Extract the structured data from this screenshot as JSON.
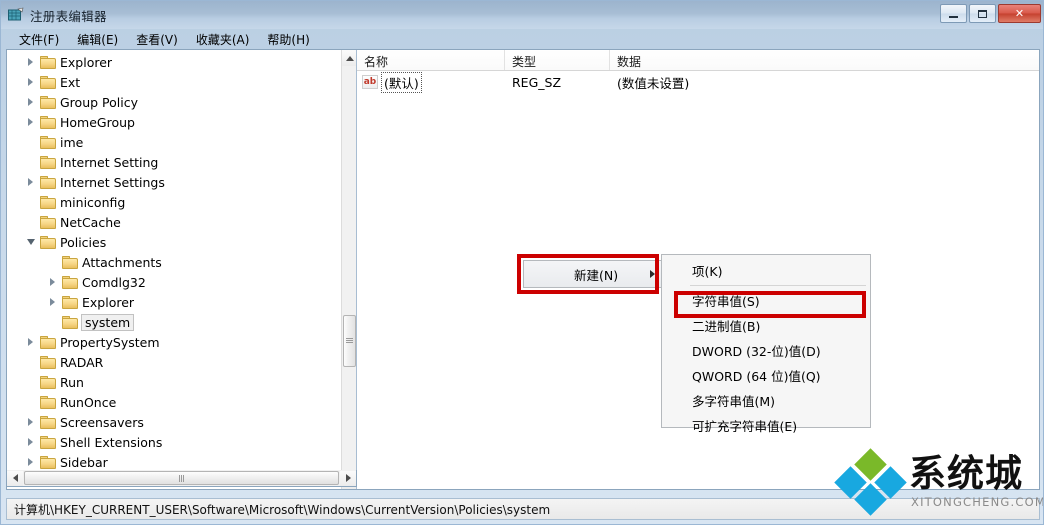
{
  "window": {
    "title": "注册表编辑器",
    "icon": "registry-editor-icon",
    "controls": {
      "minimize": "minimize-icon",
      "maximize": "maximize-icon",
      "close": "✕"
    }
  },
  "menubar": {
    "items": [
      {
        "label": "文件(F)"
      },
      {
        "label": "编辑(E)"
      },
      {
        "label": "查看(V)"
      },
      {
        "label": "收藏夹(A)"
      },
      {
        "label": "帮助(H)"
      }
    ]
  },
  "tree": {
    "items": [
      {
        "label": "Explorer",
        "indent": 2,
        "expander": "collapsed",
        "selected": false
      },
      {
        "label": "Ext",
        "indent": 2,
        "expander": "collapsed",
        "selected": false
      },
      {
        "label": "Group Policy",
        "indent": 2,
        "expander": "collapsed",
        "selected": false
      },
      {
        "label": "HomeGroup",
        "indent": 2,
        "expander": "collapsed",
        "selected": false
      },
      {
        "label": "ime",
        "indent": 2,
        "expander": "none",
        "selected": false
      },
      {
        "label": "Internet Setting",
        "indent": 2,
        "expander": "none",
        "selected": false
      },
      {
        "label": "Internet Settings",
        "indent": 2,
        "expander": "collapsed",
        "selected": false
      },
      {
        "label": "miniconfig",
        "indent": 2,
        "expander": "none",
        "selected": false
      },
      {
        "label": "NetCache",
        "indent": 2,
        "expander": "none",
        "selected": false
      },
      {
        "label": "Policies",
        "indent": 2,
        "expander": "expanded",
        "selected": false
      },
      {
        "label": "Attachments",
        "indent": 3,
        "expander": "none",
        "selected": false
      },
      {
        "label": "Comdlg32",
        "indent": 3,
        "expander": "collapsed",
        "selected": false
      },
      {
        "label": "Explorer",
        "indent": 3,
        "expander": "collapsed",
        "selected": false
      },
      {
        "label": "system",
        "indent": 3,
        "expander": "none",
        "selected": true
      },
      {
        "label": "PropertySystem",
        "indent": 2,
        "expander": "collapsed",
        "selected": false
      },
      {
        "label": "RADAR",
        "indent": 2,
        "expander": "none",
        "selected": false
      },
      {
        "label": "Run",
        "indent": 2,
        "expander": "none",
        "selected": false
      },
      {
        "label": "RunOnce",
        "indent": 2,
        "expander": "none",
        "selected": false
      },
      {
        "label": "Screensavers",
        "indent": 2,
        "expander": "collapsed",
        "selected": false
      },
      {
        "label": "Shell Extensions",
        "indent": 2,
        "expander": "collapsed",
        "selected": false
      },
      {
        "label": "Sidebar",
        "indent": 2,
        "expander": "collapsed",
        "selected": false
      }
    ]
  },
  "list": {
    "headers": [
      "名称",
      "类型",
      "数据"
    ],
    "rows": [
      {
        "name": "(默认)",
        "type": "REG_SZ",
        "data": "(数值未设置)",
        "icon": "string-value-icon"
      }
    ]
  },
  "context_menu": {
    "parent": {
      "label": "新建(N)",
      "submenu_arrow": "chevron-right-icon"
    },
    "submenu_items": [
      {
        "label": "项(K)"
      },
      {
        "label": "字符串值(S)"
      },
      {
        "label": "二进制值(B)"
      },
      {
        "label": "DWORD (32-位)值(D)"
      },
      {
        "label": "QWORD (64 位)值(Q)"
      },
      {
        "label": "多字符串值(M)"
      },
      {
        "label": "可扩充字符串值(E)"
      }
    ]
  },
  "statusbar": {
    "path": "计算机\\HKEY_CURRENT_USER\\Software\\Microsoft\\Windows\\CurrentVersion\\Policies\\system"
  },
  "watermark": {
    "cn": "系统城",
    "en": "XITONGCHENG.COM"
  },
  "colors": {
    "annotation_red": "#cc0000",
    "title_gradient_top": "#9cb4cd",
    "title_gradient_bottom": "#c6d7e9",
    "watermark_green": "#7ab929",
    "watermark_blue": "#18a8e0",
    "close_button_red": "#c5412f"
  }
}
